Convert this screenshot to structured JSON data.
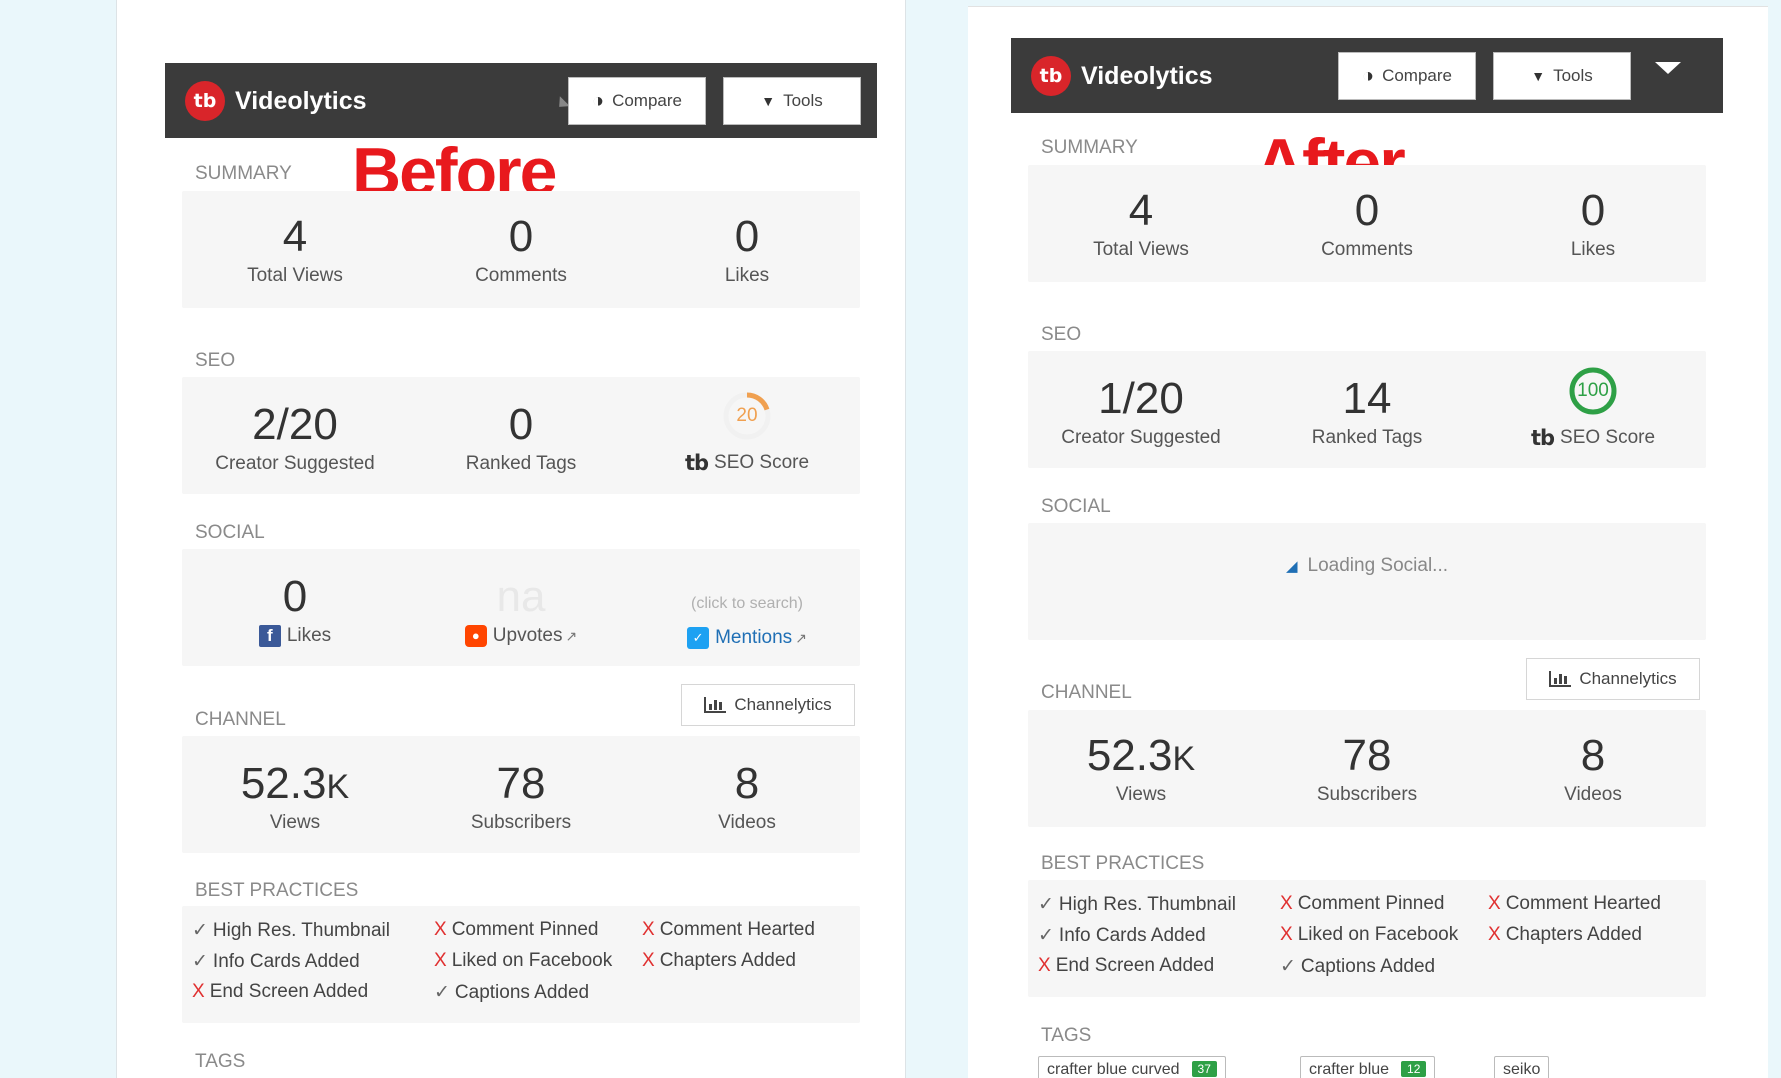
{
  "before": {
    "label": "Before",
    "brand": "Videolytics",
    "logo": "tb",
    "compare_label": "Compare",
    "tools_label": "Tools",
    "summary": {
      "title": "SUMMARY",
      "stats": [
        {
          "value": "4",
          "label": "Total Views"
        },
        {
          "value": "0",
          "label": "Comments"
        },
        {
          "value": "0",
          "label": "Likes"
        }
      ]
    },
    "seo": {
      "title": "SEO",
      "creator": {
        "value": "2/20",
        "label": "Creator Suggested"
      },
      "ranked": {
        "value": "0",
        "label": "Ranked Tags"
      },
      "score": {
        "value": "20",
        "label": "SEO Score",
        "fraction": 0.2,
        "color": "#f0a050"
      }
    },
    "social": {
      "title": "SOCIAL",
      "likes": {
        "value": "0",
        "label": "Likes"
      },
      "upvotes": {
        "value": "na",
        "label": "Upvotes"
      },
      "mentions": {
        "hint": "(click to search)",
        "label": "Mentions"
      }
    },
    "channel": {
      "title": "CHANNEL",
      "button": "Channelytics",
      "views": {
        "value": "52.3",
        "unit": "K",
        "label": "Views"
      },
      "subscribers": {
        "value": "78",
        "label": "Subscribers"
      },
      "videos": {
        "value": "8",
        "label": "Videos"
      }
    },
    "best_practices": {
      "title": "BEST PRACTICES",
      "items": [
        {
          "mark": "✓",
          "text": "High Res. Thumbnail",
          "ok": true
        },
        {
          "mark": "✓",
          "text": "Info Cards Added",
          "ok": true
        },
        {
          "mark": "X",
          "text": "End Screen Added",
          "ok": false
        },
        {
          "mark": "X",
          "text": "Comment Pinned",
          "ok": false
        },
        {
          "mark": "X",
          "text": "Liked on Facebook",
          "ok": false
        },
        {
          "mark": "✓",
          "text": "Captions Added",
          "ok": true
        },
        {
          "mark": "X",
          "text": "Comment Hearted",
          "ok": false
        },
        {
          "mark": "X",
          "text": "Chapters Added",
          "ok": false
        }
      ]
    },
    "tags_title": "TAGS"
  },
  "after": {
    "label": "After",
    "brand": "Videolytics",
    "logo": "tb",
    "compare_label": "Compare",
    "tools_label": "Tools",
    "summary": {
      "title": "SUMMARY",
      "stats": [
        {
          "value": "4",
          "label": "Total Views"
        },
        {
          "value": "0",
          "label": "Comments"
        },
        {
          "value": "0",
          "label": "Likes"
        }
      ]
    },
    "seo": {
      "title": "SEO",
      "creator": {
        "value": "1/20",
        "label": "Creator Suggested"
      },
      "ranked": {
        "value": "14",
        "label": "Ranked Tags"
      },
      "score": {
        "value": "100",
        "label": "SEO Score",
        "fraction": 1.0,
        "color": "#2ea046"
      }
    },
    "social": {
      "title": "SOCIAL",
      "loading": "Loading Social..."
    },
    "channel": {
      "title": "CHANNEL",
      "button": "Channelytics",
      "views": {
        "value": "52.3",
        "unit": "K",
        "label": "Views"
      },
      "subscribers": {
        "value": "78",
        "label": "Subscribers"
      },
      "videos": {
        "value": "8",
        "label": "Videos"
      }
    },
    "best_practices": {
      "title": "BEST PRACTICES",
      "items": [
        {
          "mark": "✓",
          "text": "High Res. Thumbnail",
          "ok": true
        },
        {
          "mark": "✓",
          "text": "Info Cards Added",
          "ok": true
        },
        {
          "mark": "X",
          "text": "End Screen Added",
          "ok": false
        },
        {
          "mark": "X",
          "text": "Comment Pinned",
          "ok": false
        },
        {
          "mark": "X",
          "text": "Liked on Facebook",
          "ok": false
        },
        {
          "mark": "✓",
          "text": "Captions Added",
          "ok": true
        },
        {
          "mark": "X",
          "text": "Comment Hearted",
          "ok": false
        },
        {
          "mark": "X",
          "text": "Chapters Added",
          "ok": false
        }
      ]
    },
    "tags_title": "TAGS",
    "tags": [
      {
        "text": "crafter blue curved",
        "count": "37"
      },
      {
        "text": "crafter blue",
        "count": "12"
      },
      {
        "text": "seiko",
        "count": ""
      }
    ]
  }
}
